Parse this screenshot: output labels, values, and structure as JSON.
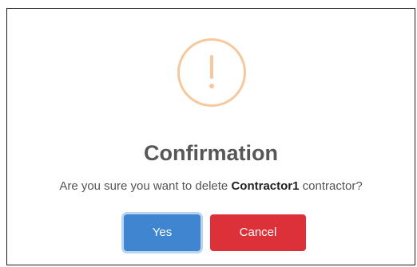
{
  "dialog": {
    "title": "Confirmation",
    "message_prefix": "Are you sure you want to delete ",
    "message_bold": "Contractor1",
    "message_suffix": " contractor?",
    "icon": "exclamation-warning-icon",
    "yes_label": "Yes",
    "cancel_label": "Cancel"
  },
  "colors": {
    "warning_icon": "#f6c89e",
    "yes_button": "#3f85cf",
    "cancel_button": "#dc3139",
    "title_text": "#575757"
  }
}
